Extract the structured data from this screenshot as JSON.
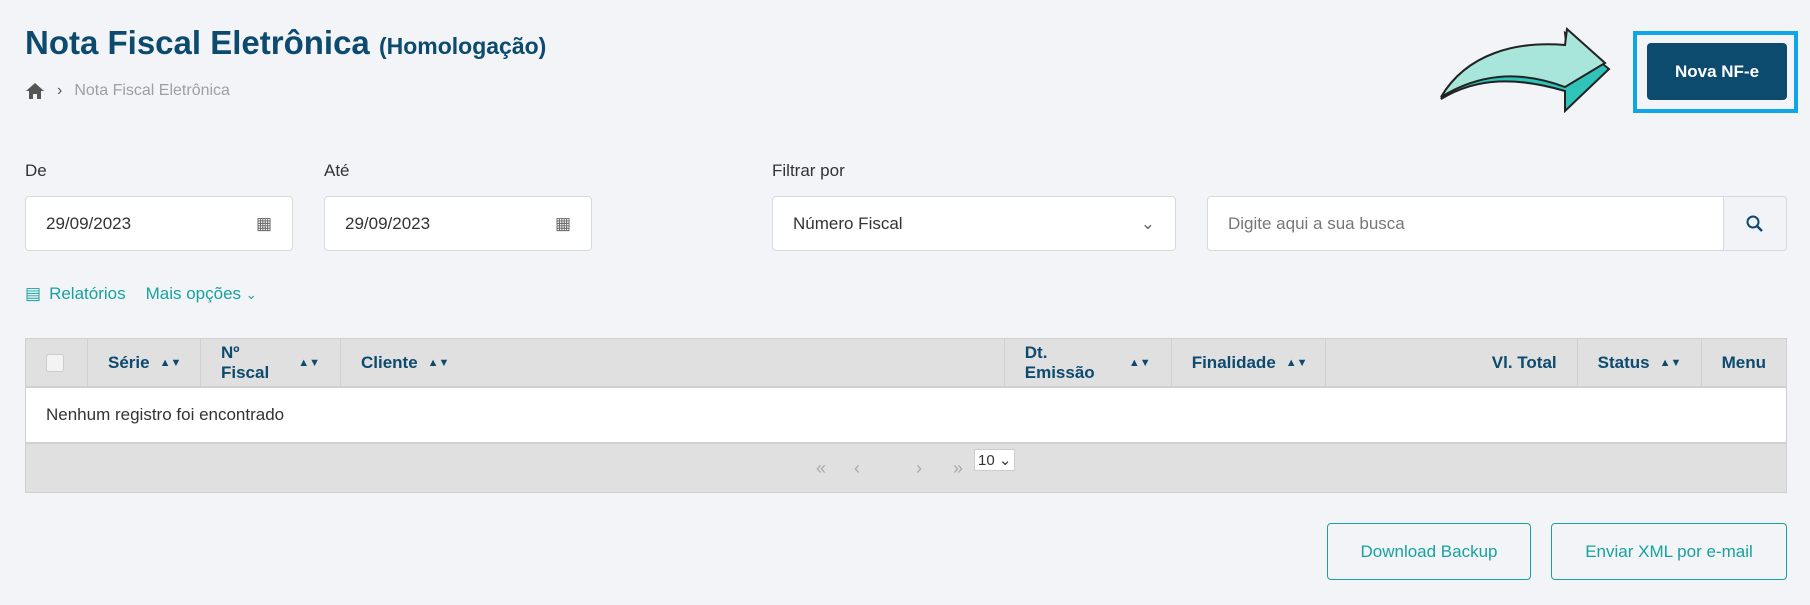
{
  "header": {
    "title": "Nota Fiscal Eletrônica",
    "subtitle": "(Homologação)",
    "breadcrumb": "Nota Fiscal Eletrônica",
    "new_button": "Nova NF-e"
  },
  "filters": {
    "from_label": "De",
    "from_value": "29/09/2023",
    "to_label": "Até",
    "to_value": "29/09/2023",
    "filter_label": "Filtrar por",
    "filter_value": "Número Fiscal",
    "search_placeholder": "Digite aqui a sua busca"
  },
  "links": {
    "reports": "Relatórios",
    "more": "Mais opções"
  },
  "table": {
    "columns": [
      "Série",
      "Nº Fiscal",
      "Cliente",
      "Dt. Emissão",
      "Finalidade",
      "Vl. Total",
      "Status",
      "Menu"
    ],
    "empty": "Nenhum registro foi encontrado",
    "page_size": "10"
  },
  "actions": {
    "download": "Download Backup",
    "email": "Enviar XML por e-mail"
  },
  "colors": {
    "primary": "#0c4a6e",
    "accent": "#17a2a0",
    "highlight": "#0ea5e9"
  }
}
